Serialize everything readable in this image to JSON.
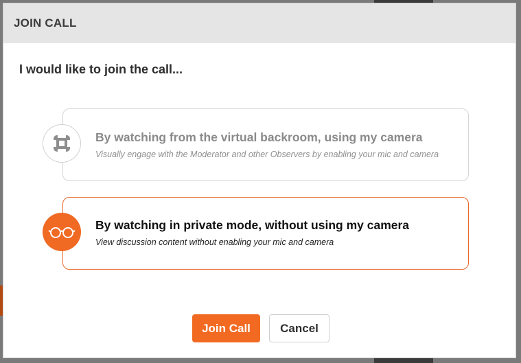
{
  "dialog": {
    "title": "JOIN CALL",
    "prompt": "I would like to join the call..."
  },
  "options": [
    {
      "id": "camera",
      "icon": "camera-focus-icon",
      "title": "By watching from the virtual backroom, using my camera",
      "description": "Visually engage with the Moderator and other Observers by enabling your mic and camera",
      "selected": false
    },
    {
      "id": "private",
      "icon": "glasses-icon",
      "title": "By watching in private mode, without using my camera",
      "description": "View discussion content without enabling your mic and camera",
      "selected": true
    }
  ],
  "buttons": {
    "join_label": "Join Call",
    "cancel_label": "Cancel"
  },
  "colors": {
    "accent": "#f26a22",
    "header_bg": "#e5e5e5"
  }
}
